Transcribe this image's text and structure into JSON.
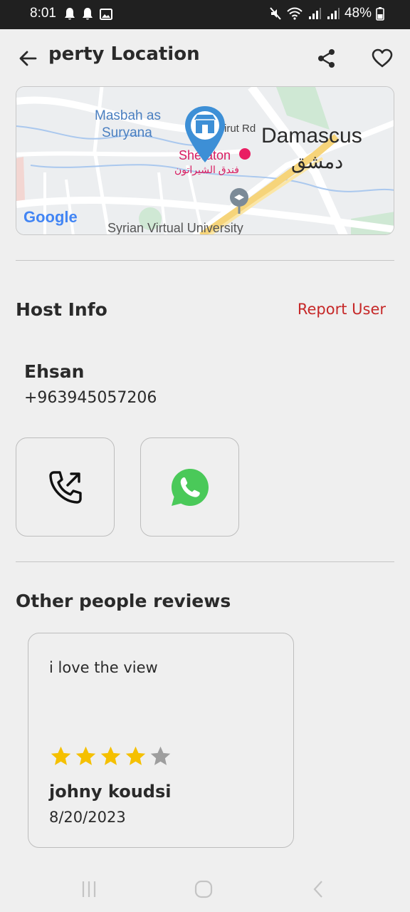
{
  "status_bar": {
    "time": "8:01",
    "battery": "48%"
  },
  "app_bar": {
    "title": "perty Location"
  },
  "map": {
    "labels": {
      "masbah_line1": "Masbah as",
      "masbah_line2": "Suryana",
      "road": "irut Rd",
      "city": "Damascus",
      "city_ar": "دمشق",
      "hotel": "Sheraton",
      "hotel_ar": "فندق الشيراتون",
      "university": "Syrian Virtual University",
      "google": "Google"
    }
  },
  "host": {
    "section_title": "Host Info",
    "report_label": "Report User",
    "name": "Ehsan",
    "phone": "+963945057206"
  },
  "reviews": {
    "section_title": "Other people reviews",
    "items": [
      {
        "text": "i love the view",
        "rating": 4,
        "max_rating": 5,
        "author": "johny koudsi",
        "date": "8/20/2023"
      }
    ]
  },
  "colors": {
    "accent_red": "#c62828",
    "star_filled": "#f5c000",
    "star_empty": "#9e9e9e",
    "whatsapp": "#4ac959",
    "pin": "#3d8fd6"
  }
}
